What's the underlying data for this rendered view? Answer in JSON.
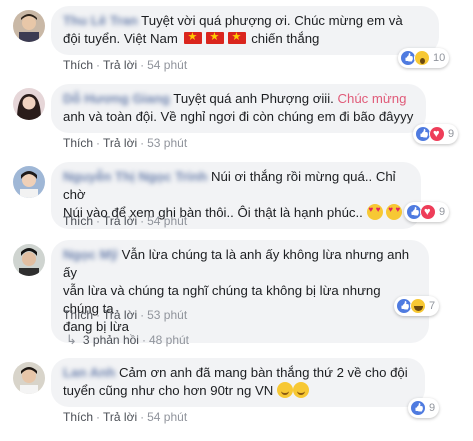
{
  "comments": [
    {
      "author": "Thu Lê Tran",
      "text1": "Tuyệt vời quá phượng ơi. Chúc mừng em và",
      "text2a": "đội tuyển. Việt Nam",
      "text2b": "chiến thắng",
      "reactions": [
        "like-icon",
        "wow-icon"
      ],
      "reaction_count": "10",
      "like": "Thích",
      "reply": "Trả lời",
      "time": "54 phút"
    },
    {
      "author": "Dỗ Hương Giang",
      "text1a": "Tuyệt quá anh Phượng ơiii.",
      "text1b": "Chúc mừng",
      "text2": "anh và toàn đội. Về nghỉ ngơi đi còn chúng em đi bão đâyyy",
      "reactions": [
        "like-icon",
        "love-icon"
      ],
      "reaction_count": "9",
      "like": "Thích",
      "reply": "Trả lời",
      "time": "53 phút"
    },
    {
      "author": "Nguyễn Thị Ngọc Trinh",
      "text1": "Núi ơi thắng rồi mừng quá.. Chỉ chờ",
      "text2": "Núi vào để xem ghi bàn thôi.. Ôi thật là hạnh phúc..",
      "reactions": [
        "like-icon",
        "love-icon"
      ],
      "reaction_count": "9",
      "like": "Thích",
      "reply": "Trả lời",
      "time": "54 phút"
    },
    {
      "author": "Ngọc Mỹ",
      "text1": "Vẫn lừa chúng ta là anh ấy không lừa nhưng anh ấy",
      "text2": "vẫn lừa và chúng ta nghĩ chúng ta không bị lừa nhưng chúng ta",
      "text3": "đang bị lừa",
      "reactions": [
        "like-icon",
        "haha-icon"
      ],
      "reaction_count": "7",
      "like": "Thích",
      "reply": "Trả lời",
      "time": "53 phút",
      "replies": "3 phản hồi",
      "replies_time": "48 phút"
    },
    {
      "author": "Lan Anh",
      "text1": "Cảm ơn anh đã mang bàn thắng thứ 2 về cho đội",
      "text2": "tuyển cũng như cho hơn 90tr ng VN",
      "reactions": [
        "like-icon"
      ],
      "reaction_count": "9",
      "like": "Thích",
      "reply": "Trả lời",
      "time": "54 phút"
    }
  ],
  "colors": {
    "author": "#385898",
    "bubble": "#f2f3f5",
    "meta": "#90949c",
    "highlight": "#e05b79"
  }
}
